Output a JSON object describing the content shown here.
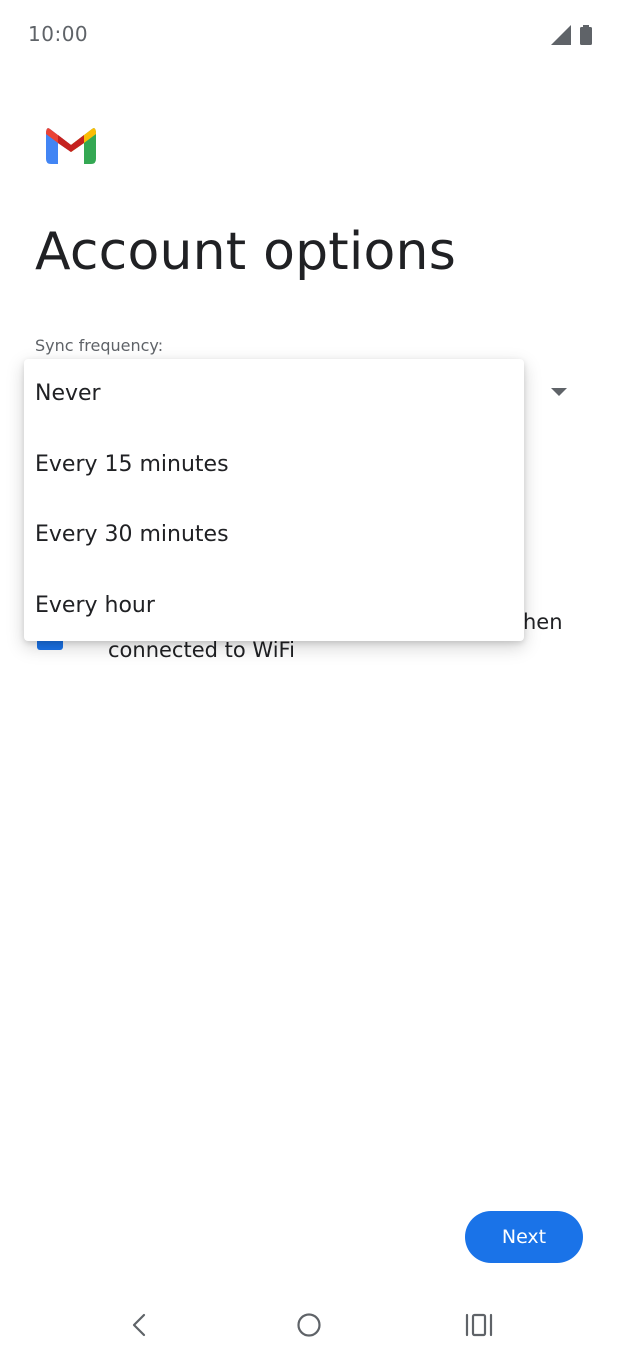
{
  "status_bar": {
    "time": "10:00",
    "signal_icon": "signal-icon",
    "battery_icon": "battery-icon"
  },
  "app": {
    "logo_icon": "gmail-logo-icon"
  },
  "page": {
    "title": "Account options"
  },
  "sync": {
    "label": "Sync frequency:",
    "options": [
      "Never",
      "Every 15 minutes",
      "Every 30 minutes",
      "Every hour"
    ]
  },
  "wifi_option": {
    "text_tail": "hen",
    "text_line2": "connected to WiFi",
    "checked": true
  },
  "actions": {
    "next_label": "Next"
  },
  "nav": {
    "back_icon": "back-icon",
    "home_icon": "home-icon",
    "recents_icon": "recents-icon"
  },
  "colors": {
    "accent": "#1a73e8",
    "text_primary": "#202124",
    "text_secondary": "#5f6368"
  }
}
